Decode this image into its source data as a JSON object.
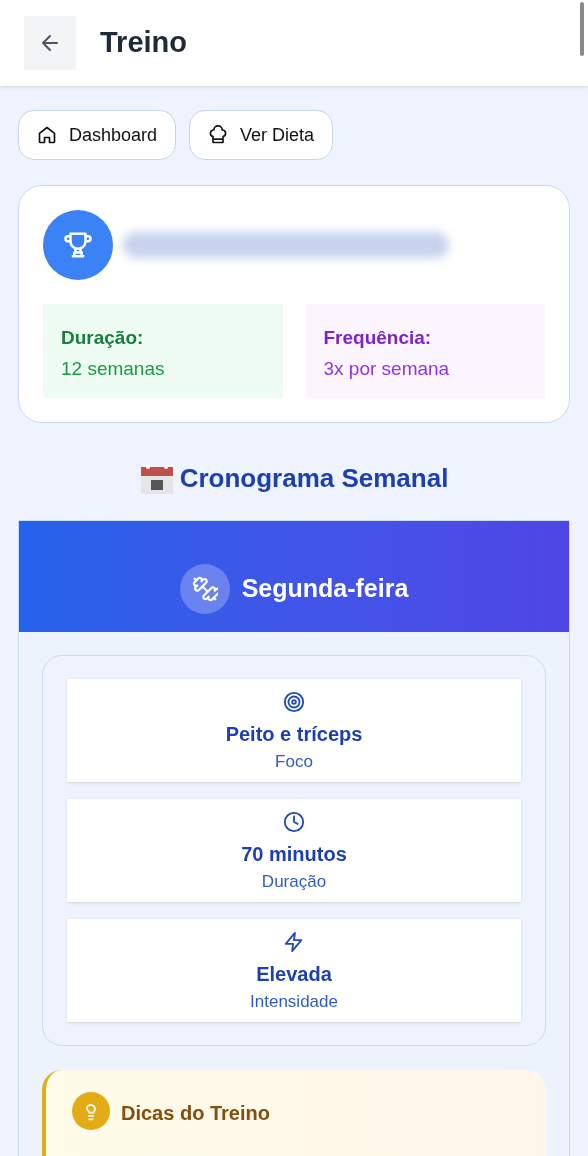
{
  "header": {
    "title": "Treino"
  },
  "nav_buttons": [
    {
      "label": "Dashboard",
      "kind": "home"
    },
    {
      "label": "Ver Dieta",
      "kind": "chef"
    }
  ],
  "plan_card": {
    "stats": [
      {
        "label": "Duração:",
        "value": "12 semanas",
        "kind": "green"
      },
      {
        "label": "Frequência:",
        "value": "3x por semana",
        "kind": "purple"
      }
    ]
  },
  "schedule": {
    "title": "Cronograma Semanal",
    "day": "Segunda-feira",
    "items": [
      {
        "value": "Peito e tríceps",
        "label": "Foco",
        "kind": "target"
      },
      {
        "value": "70 minutos",
        "label": "Duração",
        "kind": "clock"
      },
      {
        "value": "Elevada",
        "label": "Intensidade",
        "kind": "bolt"
      }
    ],
    "tips": {
      "title": "Dicas do Treino"
    }
  }
}
